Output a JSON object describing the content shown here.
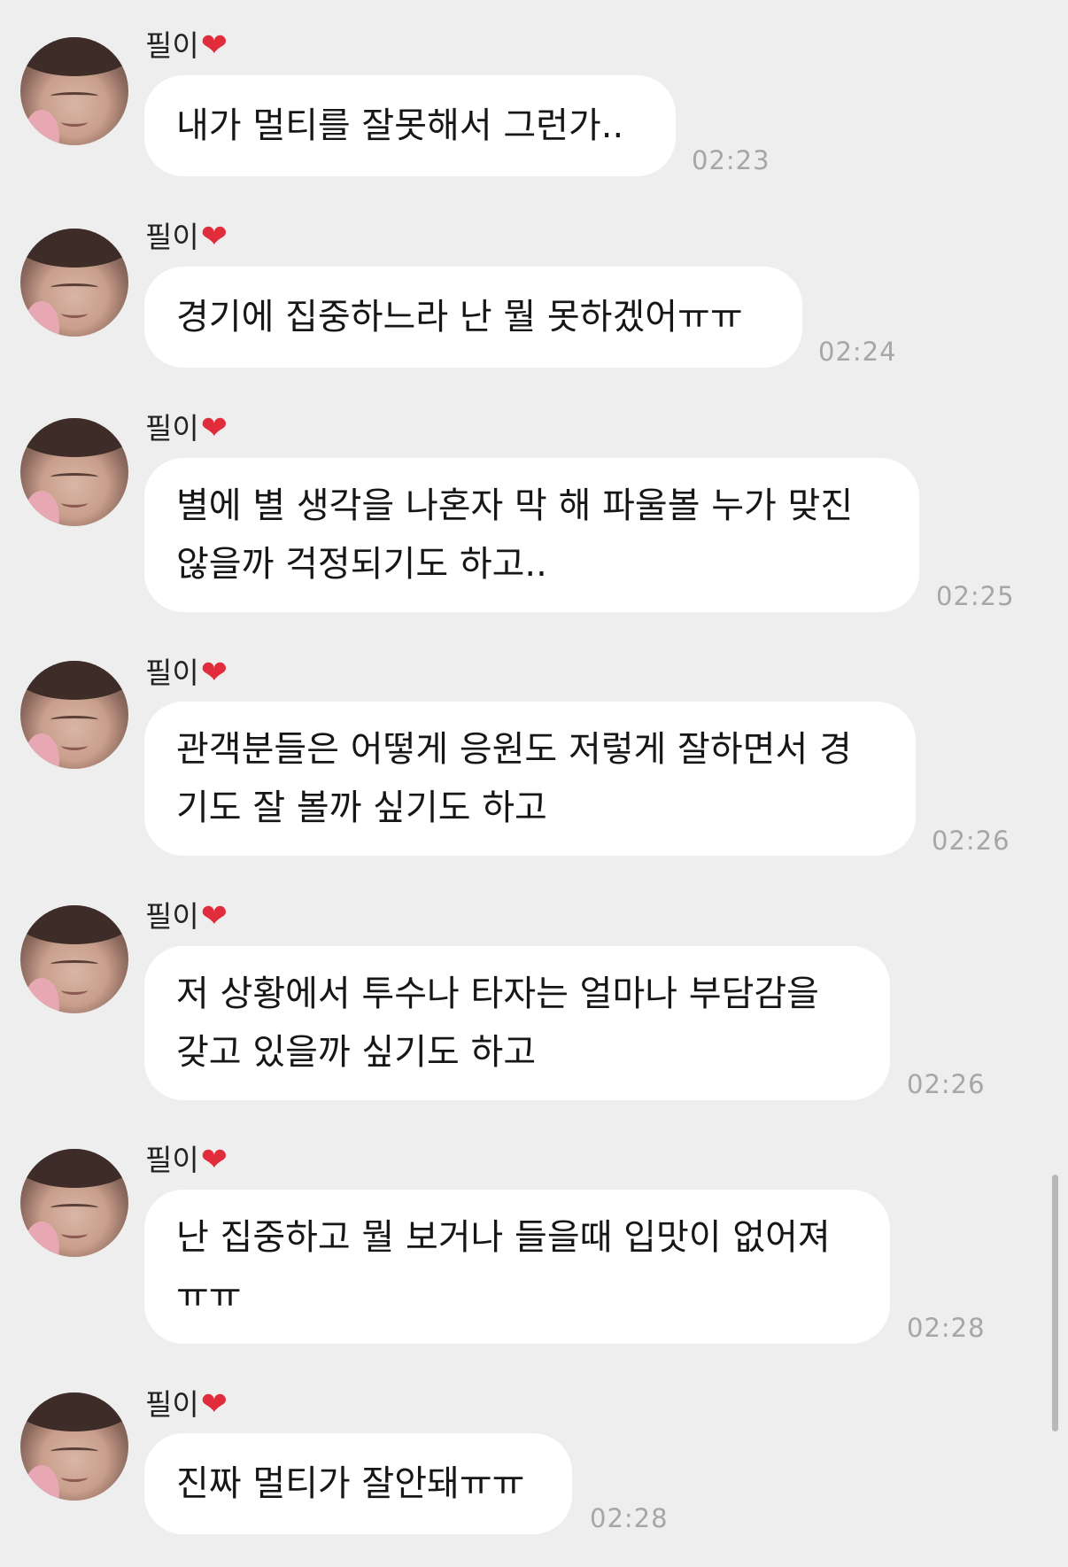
{
  "sender": {
    "name": "필이",
    "badge_icon": "red-heart-icon"
  },
  "messages": [
    {
      "text": "내가 멀티를 잘못해서 그런가..",
      "time": "02:23"
    },
    {
      "text": "경기에 집중하느라 난 뭘 못하겠어ㅠㅠ",
      "time": "02:24"
    },
    {
      "text": "별에 별 생각을 나혼자 막 해 파울볼 누가 맞진\n않을까 걱정되기도 하고..",
      "time": "02:25"
    },
    {
      "text": "관객분들은 어떻게 응원도 저렇게 잘하면서 경\n기도 잘 볼까 싶기도 하고",
      "time": "02:26"
    },
    {
      "text": "저 상황에서 투수나 타자는 얼마나 부담감을\n갖고 있을까 싶기도 하고",
      "time": "02:26"
    },
    {
      "text": "난 집중하고 뭘 보거나 들을때 입맛이 없어져\nㅠㅠ",
      "time": "02:28"
    },
    {
      "text": "진짜 멀티가 잘안돼ㅠㅠ",
      "time": "02:28"
    }
  ],
  "colors": {
    "background": "#eeeeee",
    "bubble": "#ffffff",
    "timestamp": "#a6a6a6",
    "heart": "#e12d3b"
  }
}
